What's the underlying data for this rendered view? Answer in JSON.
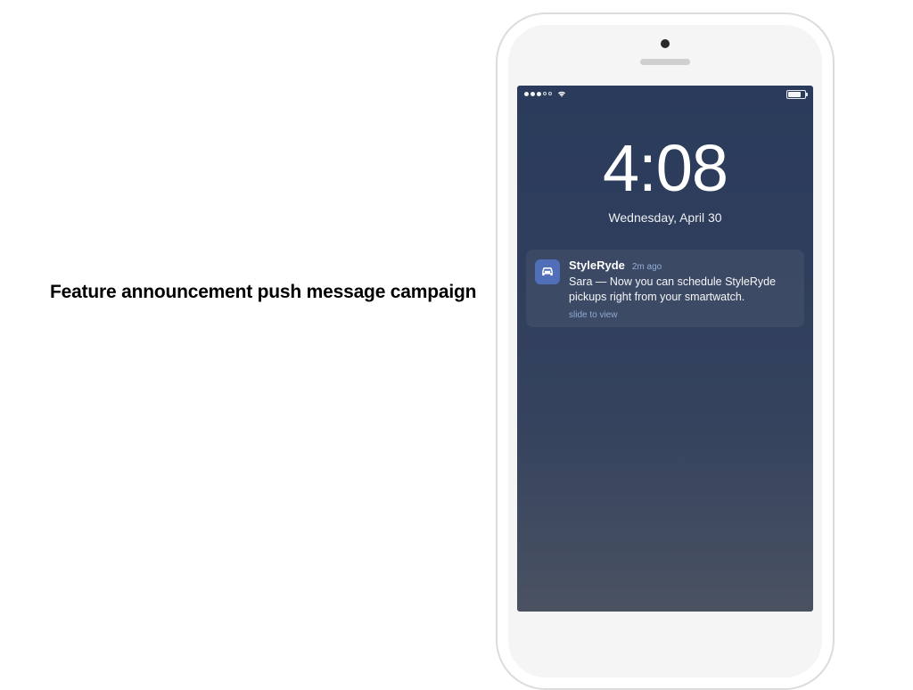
{
  "slide": {
    "caption": "Feature announcement push message campaign"
  },
  "lockscreen": {
    "time": "4:08",
    "date": "Wednesday, April 30"
  },
  "notification": {
    "app_name": "StyleRyde",
    "timestamp": "2m ago",
    "message": "Sara — Now you can schedule StyleRyde pickups right from your smartwatch.",
    "action_hint": "slide to view",
    "icon_name": "car-icon"
  }
}
